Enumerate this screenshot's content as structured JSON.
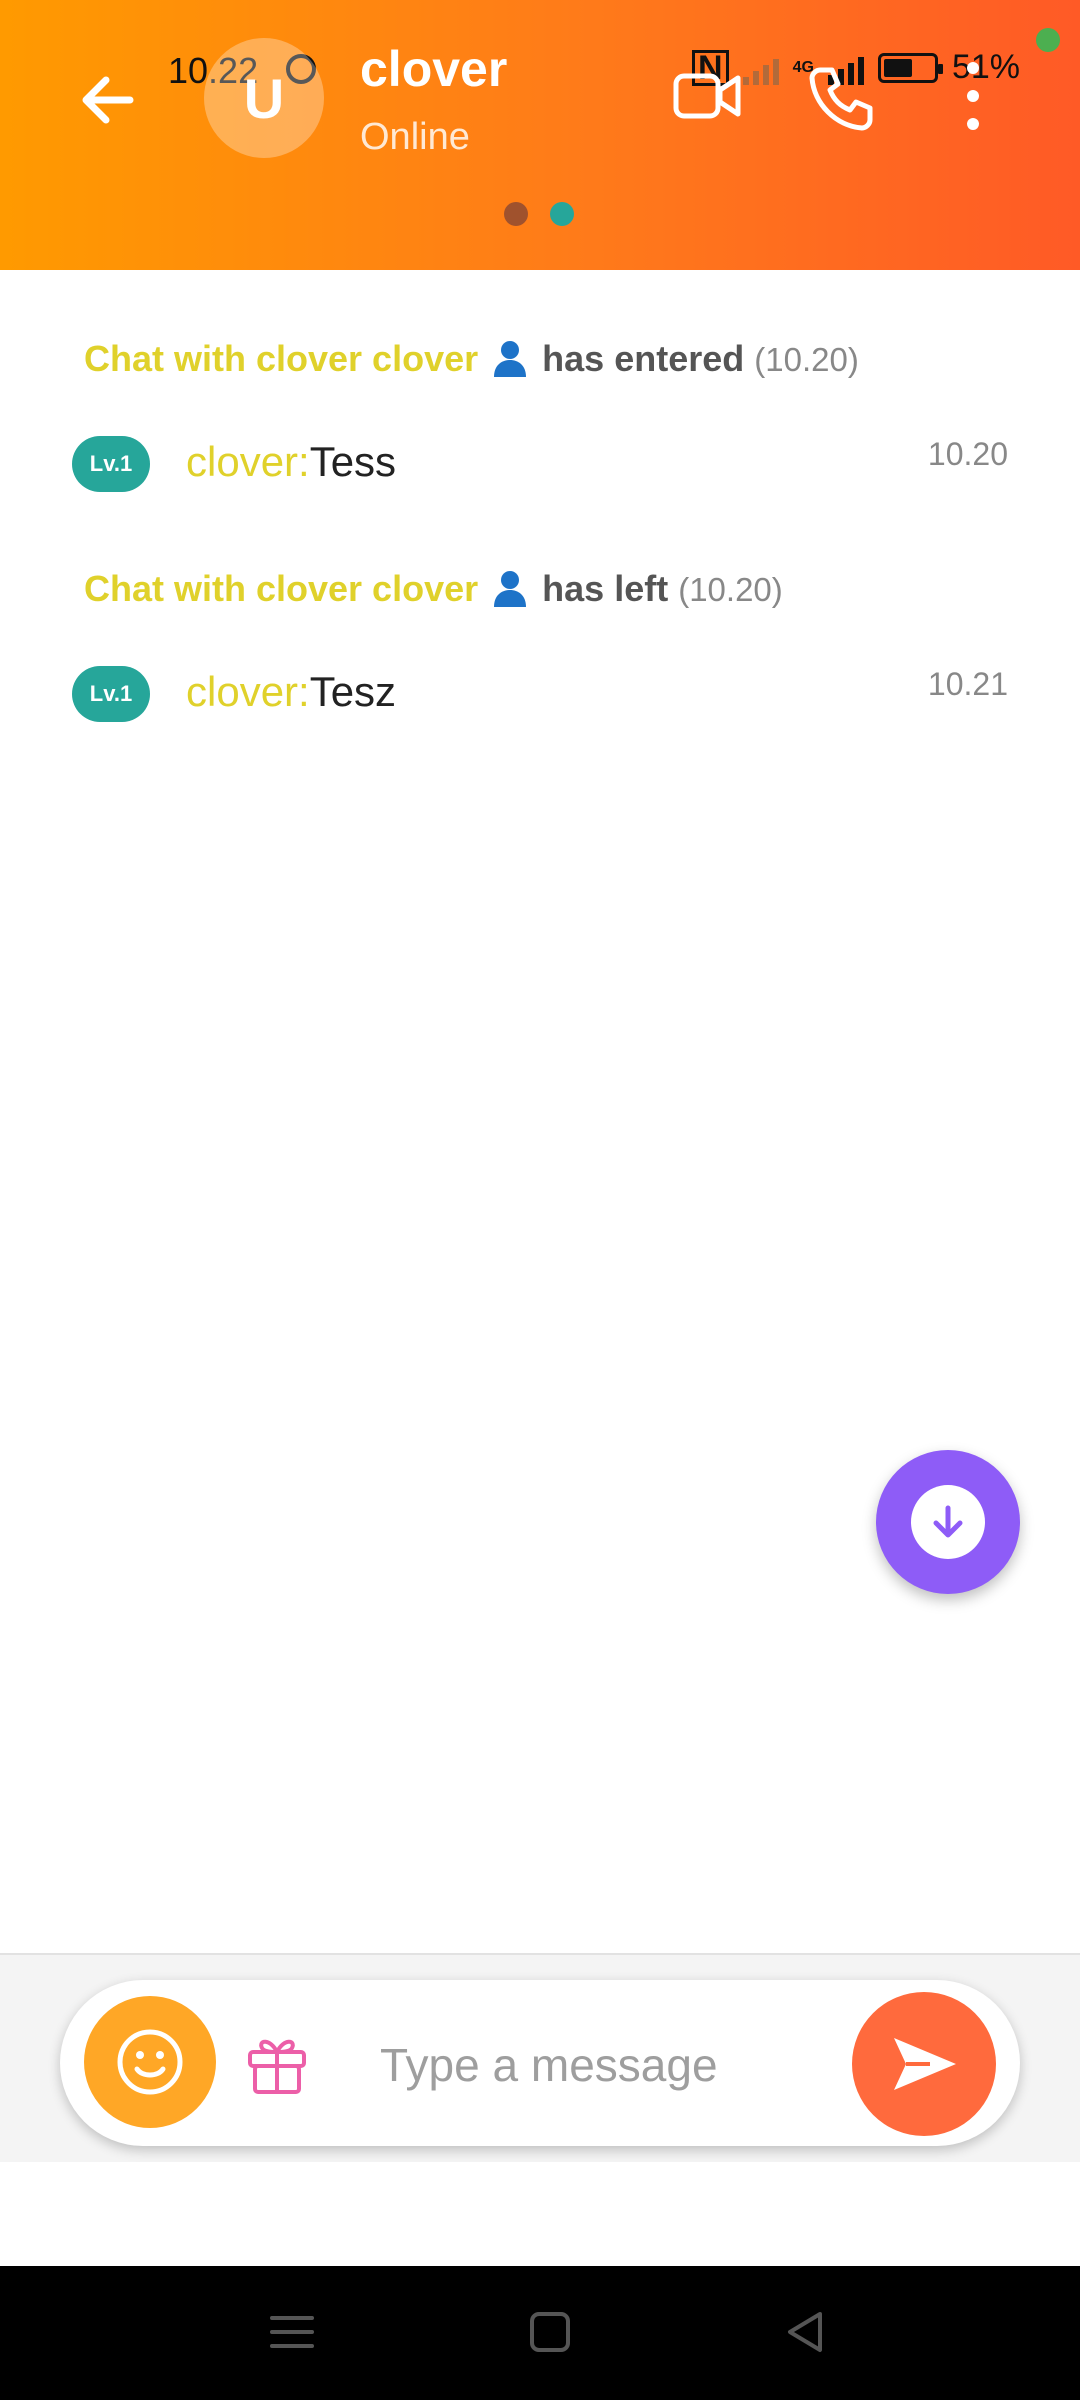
{
  "status_bar": {
    "time": "10.22",
    "network": "4G",
    "battery": "51%"
  },
  "header": {
    "avatar_letter": "U",
    "contact_name": "clover",
    "contact_status": "Online",
    "page_dots": [
      "#a0522d",
      "#26a69a"
    ]
  },
  "messages": [
    {
      "type": "system",
      "title": "Chat with clover clover",
      "action": "has entered",
      "time": "(10.20)"
    },
    {
      "type": "chat",
      "level": "Lv.1",
      "sender": "clover:",
      "text": "Tess",
      "time": "10.20"
    },
    {
      "type": "system",
      "title": "Chat with clover clover",
      "action": "has left",
      "time": "(10.20)"
    },
    {
      "type": "chat",
      "level": "Lv.1",
      "sender": "clover:",
      "text": "Tesz",
      "time": "10.21"
    }
  ],
  "composer": {
    "placeholder": "Type a message"
  },
  "icons": {
    "back": "arrow-left-icon",
    "video": "video-camera-icon",
    "call": "phone-icon",
    "more": "more-vertical-icon",
    "scroll": "arrow-down-icon",
    "emoji": "smiley-icon",
    "gift": "gift-icon",
    "send": "send-icon"
  },
  "colors": {
    "header_start": "#ff9a00",
    "header_end": "#ff5a26",
    "accent_yellow": "#e0d12b",
    "level_badge": "#26a69a",
    "fab": "#8e5cf7",
    "emoji_button": "#ffa726",
    "send_button": "#ff6a3d"
  }
}
